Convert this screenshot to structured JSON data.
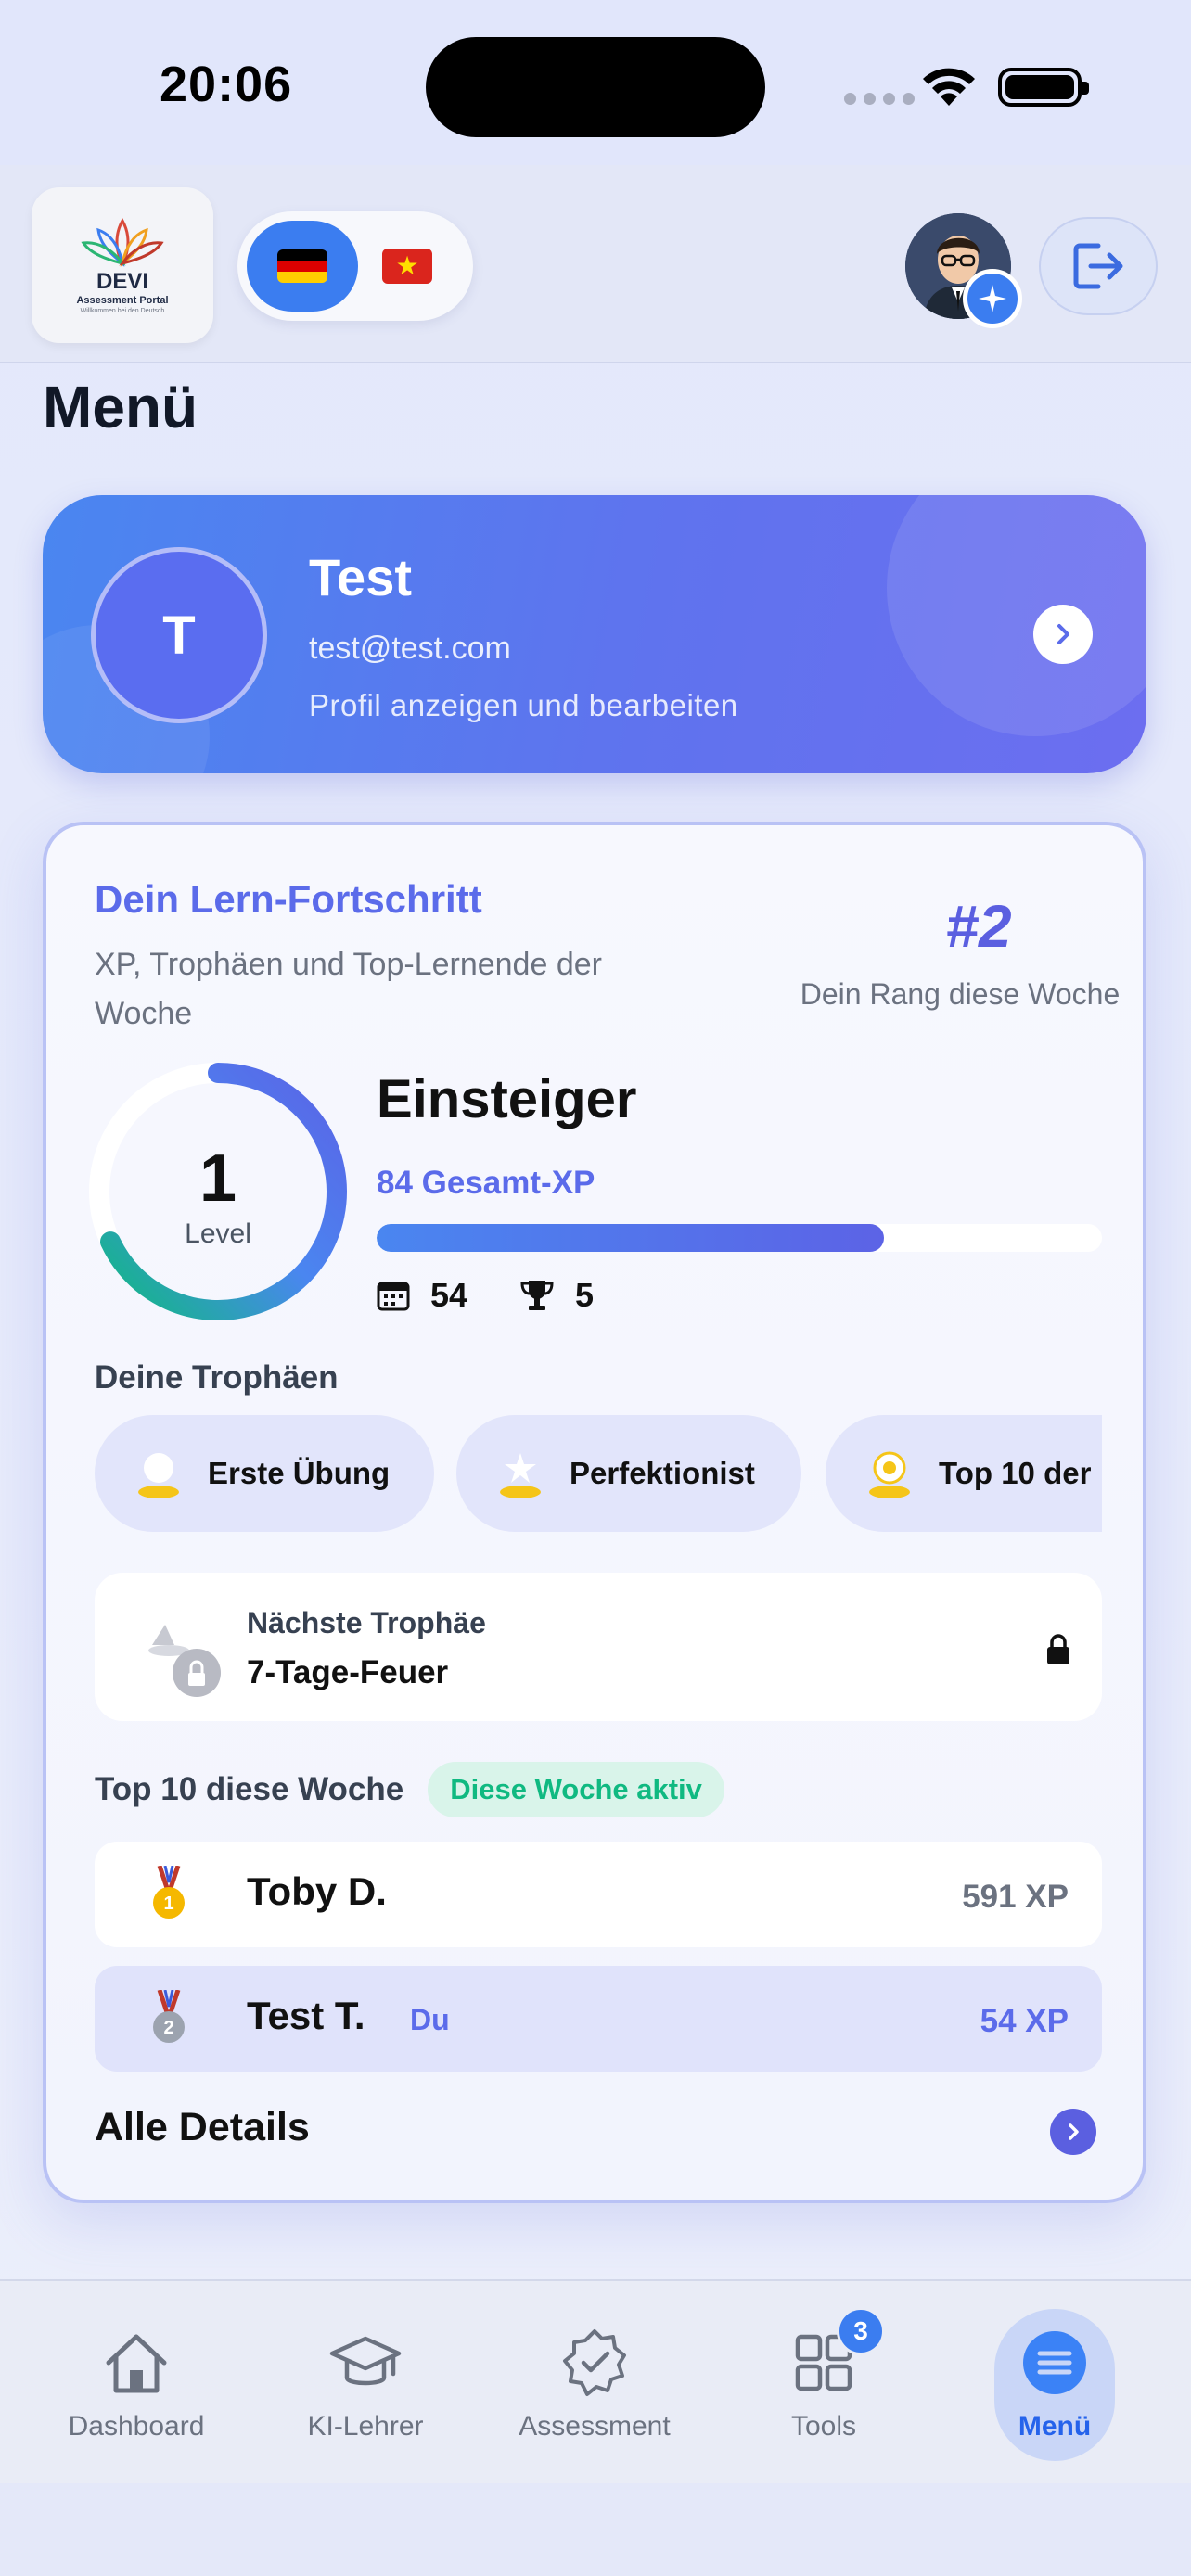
{
  "status_bar": {
    "time": "20:06"
  },
  "header": {
    "logo": {
      "title": "DEVI",
      "subtitle": "Assessment Portal",
      "tagline": "Willkommen bei den Deutsch"
    },
    "languages": [
      {
        "code": "de",
        "active": true
      },
      {
        "code": "vn",
        "active": false
      }
    ]
  },
  "page": {
    "title": "Menü"
  },
  "profile": {
    "initial": "T",
    "name": "Test",
    "email": "test@test.com",
    "hint": "Profil anzeigen und bearbeiten"
  },
  "progress": {
    "title": "Dein Lern-Fortschritt",
    "subtitle": "XP, Trophäen und Top-Lernende der Woche",
    "rank": "#2",
    "rank_label": "Dein Rang diese Woche",
    "level": "1",
    "level_label": "Level",
    "level_name": "Einsteiger",
    "total_xp": "84 Gesamt-XP",
    "xp_progress_fraction": 0.7,
    "streak_days": "54",
    "trophy_count": "5",
    "trophies_heading": "Deine Trophäen",
    "trophies": [
      "Erste Übung",
      "Perfektionist",
      "Top 10 der"
    ],
    "next_trophy_label": "Nächste Trophäe",
    "next_trophy_name": "7-Tage-Feuer",
    "top10_heading": "Top 10 diese Woche",
    "top10_badge": "Diese Woche aktiv",
    "leaderboard": [
      {
        "name": "Toby D.",
        "xp": "591 XP",
        "you": ""
      },
      {
        "name": "Test T.",
        "xp": "54 XP",
        "you": "Du"
      }
    ],
    "details_link": "Alle Details"
  },
  "tabbar": {
    "tabs": [
      {
        "label": "Dashboard",
        "icon": "home-icon"
      },
      {
        "label": "KI-Lehrer",
        "icon": "graduation-cap-icon"
      },
      {
        "label": "Assessment",
        "icon": "badge-check-icon"
      },
      {
        "label": "Tools",
        "icon": "grid-icon",
        "badge": "3"
      },
      {
        "label": "Menü",
        "icon": "menu-icon"
      }
    ]
  },
  "colors": {
    "accent": "#5b6bea",
    "primary_blue": "#3b7df0",
    "success": "#10b981"
  }
}
